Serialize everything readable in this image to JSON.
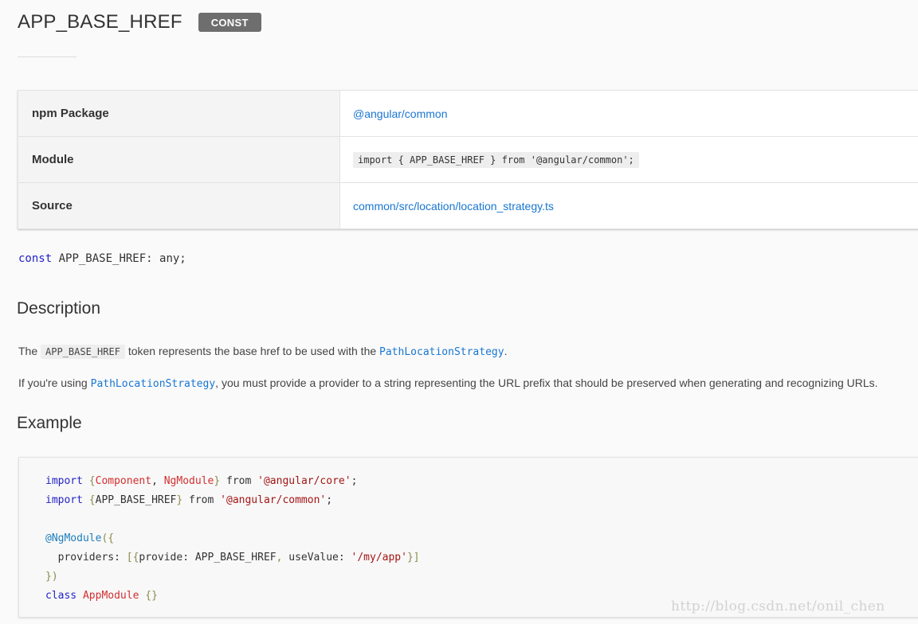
{
  "header": {
    "title": "APP_BASE_HREF",
    "badge": "CONST"
  },
  "info_table": {
    "rows": [
      {
        "key": "npm Package",
        "value": "@angular/common"
      },
      {
        "key": "Module",
        "value": "import { APP_BASE_HREF } from '@angular/common';"
      },
      {
        "key": "Source",
        "value": "common/src/location/location_strategy.ts"
      }
    ]
  },
  "signature": {
    "keyword": "const",
    "rest": " APP_BASE_HREF: any;"
  },
  "description": {
    "heading": "Description",
    "p1": {
      "before": "The ",
      "code": "APP_BASE_HREF",
      "middle": " token represents the base href to be used with the ",
      "link": "PathLocationStrategy",
      "after": "."
    },
    "p2": {
      "before": "If you're using ",
      "link": "PathLocationStrategy",
      "after": ", you must provide a provider to a string representing the URL prefix that should be preserved when generating and recognizing URLs."
    }
  },
  "example": {
    "heading": "Example",
    "code": {
      "l1": {
        "kw": "import",
        "b1": " {",
        "id1": "Component",
        "sep": ", ",
        "id2": "NgModule",
        "b2": "}",
        "from": " from ",
        "str": "'@angular/core'",
        "end": ";"
      },
      "l2": {
        "kw": "import",
        "b1": " {",
        "id": "APP_BASE_HREF",
        "b2": "}",
        "from": " from ",
        "str": "'@angular/common'",
        "end": ";"
      },
      "l4": {
        "dec": "@NgModule",
        "open": "({"
      },
      "l5": {
        "indent": "  providers: ",
        "open": "[{",
        "prov": "provide: APP_BASE_HREF",
        "comma": ",",
        "use": " useValue: ",
        "str": "'/my/app'",
        "close": "}]"
      },
      "l6": {
        "close": "})"
      },
      "l7": {
        "kw": "class",
        "name": " AppModule",
        "body": " {}"
      }
    }
  },
  "watermark": "http://blog.csdn.net/onil_chen"
}
